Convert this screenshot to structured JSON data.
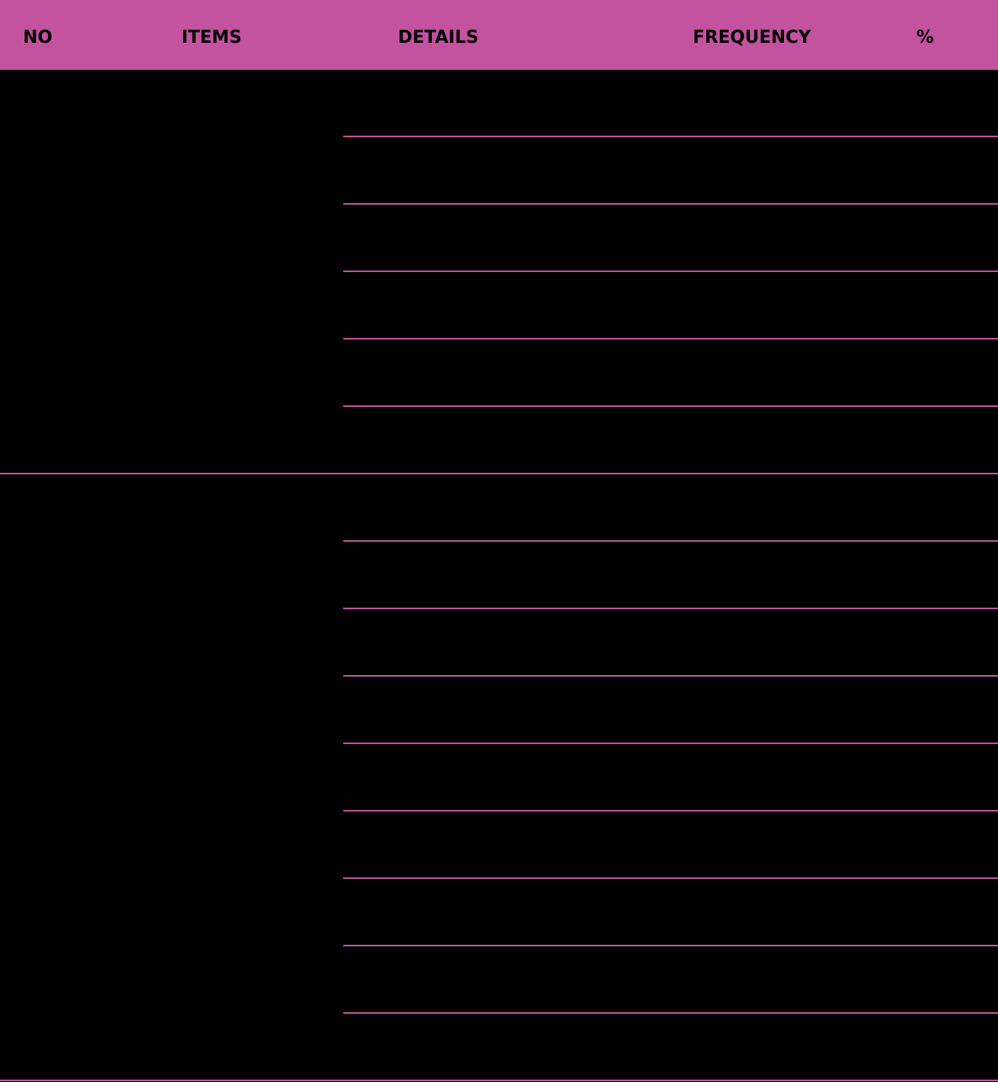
{
  "table": {
    "headers": {
      "no": "NO",
      "items": "ITEMS",
      "details": "DETAILS",
      "frequency": "FREQUENCY",
      "percent": "%"
    },
    "groups": [
      {
        "no": "",
        "item": "",
        "rows": [
          {
            "details": "",
            "frequency": "",
            "percent": ""
          },
          {
            "details": "",
            "frequency": "",
            "percent": ""
          },
          {
            "details": "",
            "frequency": "",
            "percent": ""
          },
          {
            "details": "",
            "frequency": "",
            "percent": ""
          },
          {
            "details": "",
            "frequency": "",
            "percent": ""
          },
          {
            "details": "",
            "frequency": "",
            "percent": ""
          }
        ]
      },
      {
        "no": "",
        "item": "",
        "rows": [
          {
            "details": "",
            "frequency": "",
            "percent": ""
          },
          {
            "details": "",
            "frequency": "",
            "percent": ""
          },
          {
            "details": "",
            "frequency": "",
            "percent": ""
          },
          {
            "details": "",
            "frequency": "",
            "percent": ""
          },
          {
            "details": "",
            "frequency": "",
            "percent": ""
          },
          {
            "details": "",
            "frequency": "",
            "percent": ""
          },
          {
            "details": "",
            "frequency": "",
            "percent": ""
          },
          {
            "details": "",
            "frequency": "",
            "percent": ""
          },
          {
            "details": "",
            "frequency": "",
            "percent": ""
          }
        ]
      }
    ]
  },
  "colors": {
    "header_background": "#c3529f",
    "body_background": "#000000",
    "rule": "#c3529f",
    "header_text": "#000000"
  }
}
